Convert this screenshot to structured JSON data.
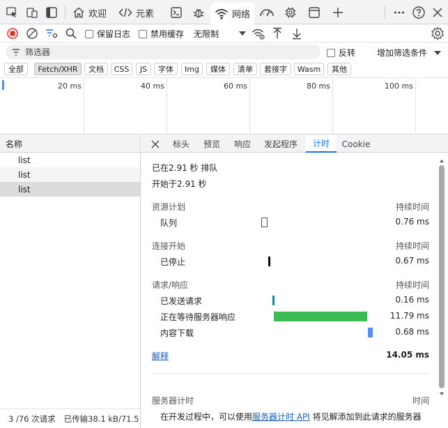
{
  "topbar": {
    "tabs": [
      {
        "label": "欢迎"
      },
      {
        "label": "元素"
      },
      {
        "label": ""
      },
      {
        "label": ""
      },
      {
        "label": "网络"
      },
      {
        "label": ""
      },
      {
        "label": ""
      },
      {
        "label": ""
      }
    ]
  },
  "toolbar": {
    "preserve_log": "保留日志",
    "disable_cache": "禁用缓存",
    "throttle": "无限制"
  },
  "filter": {
    "placeholder": "筛选器",
    "invert": "反转",
    "more_filters": "增加筛选条件"
  },
  "chips": [
    "全部",
    "Fetch/XHR",
    "文档",
    "CSS",
    "JS",
    "字体",
    "Img",
    "媒体",
    "清单",
    "套接字",
    "Wasm",
    "其他"
  ],
  "overview": {
    "ticks": [
      "20 ms",
      "40 ms",
      "60 ms",
      "80 ms",
      "100 ms"
    ]
  },
  "requests": {
    "header": "名称",
    "rows": [
      "list",
      "list",
      "list"
    ],
    "selected_index": 2,
    "status_count": "3 /76 次请求",
    "status_transfer": "已传输38.1 kB/71.5"
  },
  "detail_tabs": [
    "标头",
    "预览",
    "响应",
    "发起程序",
    "计时",
    "Cookie"
  ],
  "timing": {
    "queued_at": "已在2.91 秒 排队",
    "started_at": "开始于2.91 秒",
    "sections": [
      {
        "title": "资源计划",
        "duration_header": "持续时间",
        "rows": [
          {
            "label": "队列",
            "value": "0.76 ms",
            "start": 0.0,
            "length": 0.006,
            "color": "#ffffff"
          }
        ]
      },
      {
        "title": "连接开始",
        "duration_header": "持续时间",
        "rows": [
          {
            "label": "已停止",
            "value": "0.67 ms",
            "start": 0.063,
            "length": 0.005,
            "color": "#000000"
          }
        ]
      },
      {
        "title": "请求/响应",
        "duration_header": "持续时间",
        "rows": [
          {
            "label": "已发送请求",
            "value": "0.16 ms",
            "start": 0.1,
            "length": 0.004,
            "color": "#0b8fa0"
          },
          {
            "label": "正在等待服务器响应",
            "value": "11.79 ms",
            "start": 0.11,
            "length": 0.84,
            "color": "#3cba54"
          },
          {
            "label": "内容下载",
            "value": "0.68 ms",
            "start": 0.955,
            "length": 0.045,
            "color": "#4f8ff7"
          }
        ]
      }
    ],
    "explain_link": "解释",
    "total": "14.05 ms",
    "server_timing_title": "服务器计时",
    "server_timing_header": "时间",
    "server_text_before": "在开发过程中，可以使用",
    "server_link": "服务器计时 API",
    "server_text_after": " 将见解添加到此请求的服务器"
  }
}
